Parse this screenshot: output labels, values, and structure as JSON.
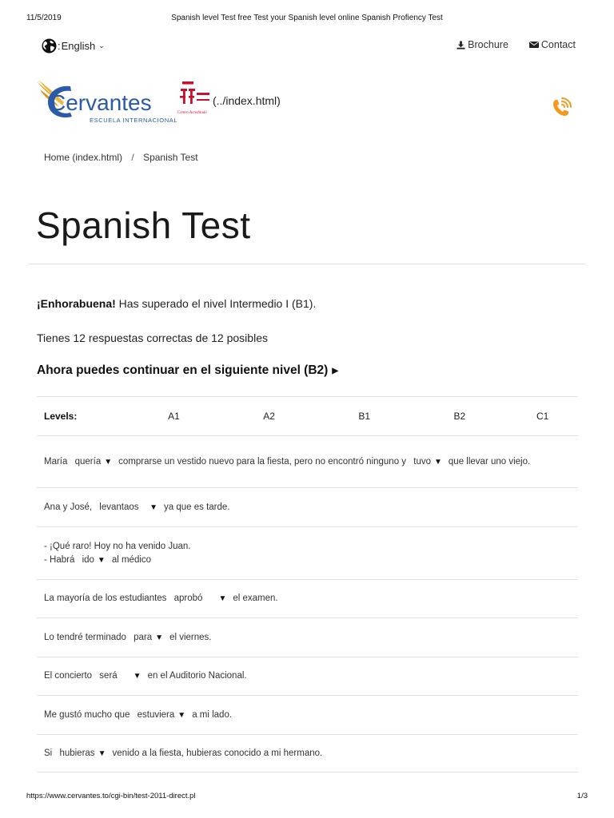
{
  "print_header": {
    "date": "11/5/2019",
    "title": "Spanish level Test free Test your Spanish level online Spanish Profiency Test"
  },
  "topbar": {
    "language": "English",
    "brochure": "Brochure",
    "contact": "Contact"
  },
  "logo": {
    "name": "Cervantes",
    "subtitle": "ESCUELA INTERNACIONAL",
    "badge_text": "Centro Acreditado",
    "href_text": "(../index.html)",
    "colors": {
      "blue": "#2a5aa8",
      "gold": "#e0a321",
      "red": "#c8102e"
    }
  },
  "breadcrumb": {
    "home": "Home (index.html)",
    "separator": "/",
    "current": "Spanish Test"
  },
  "page_title": "Spanish Test",
  "result": {
    "congrats_bold": "¡Enhorabuena!",
    "congrats_rest": " Has superado el nivel Intermedio I (B1).",
    "score_text": "Tienes 12 respuestas correctas de 12 posibles",
    "next_level": "Ahora puedes continuar en el siguiente nivel (B2)"
  },
  "levels": {
    "label": "Levels:",
    "items": [
      "A1",
      "A2",
      "B1",
      "B2",
      "C1"
    ]
  },
  "questions": [
    {
      "pre": "María",
      "sel1": "quería",
      "mid": "comprarse un vestido nuevo para la fiesta, pero no encontró ninguno y",
      "sel2": "tuvo",
      "post": "que llevar uno viejo."
    },
    {
      "pre": "Ana y José,",
      "sel1": "levantaos   ",
      "post": "ya que es tarde."
    },
    {
      "line1": "- ¡Qué raro! Hoy no ha venido Juan.",
      "pre": "- Habrá",
      "sel1": "ido",
      "post": "al médico"
    },
    {
      "pre": "La mayoría de los estudiantes",
      "sel1": "aprobó     ",
      "post": "el examen."
    },
    {
      "pre": "Lo tendré terminado",
      "sel1": "para",
      "post": "el viernes."
    },
    {
      "pre": "El concierto",
      "sel1": "será     ",
      "post": "en el Auditorio Nacional."
    },
    {
      "pre": "Me gustó mucho que",
      "sel1": "estuviera",
      "post": "a mi lado."
    },
    {
      "pre": "Si",
      "sel1": "hubieras",
      "post": "venido a la fiesta, hubieras conocido a mi hermano."
    }
  ],
  "accent_color": "#f39a1e",
  "print_footer": {
    "url": "https://www.cervantes.to/cgi-bin/test-2011-direct.pl",
    "page": "1/3"
  }
}
